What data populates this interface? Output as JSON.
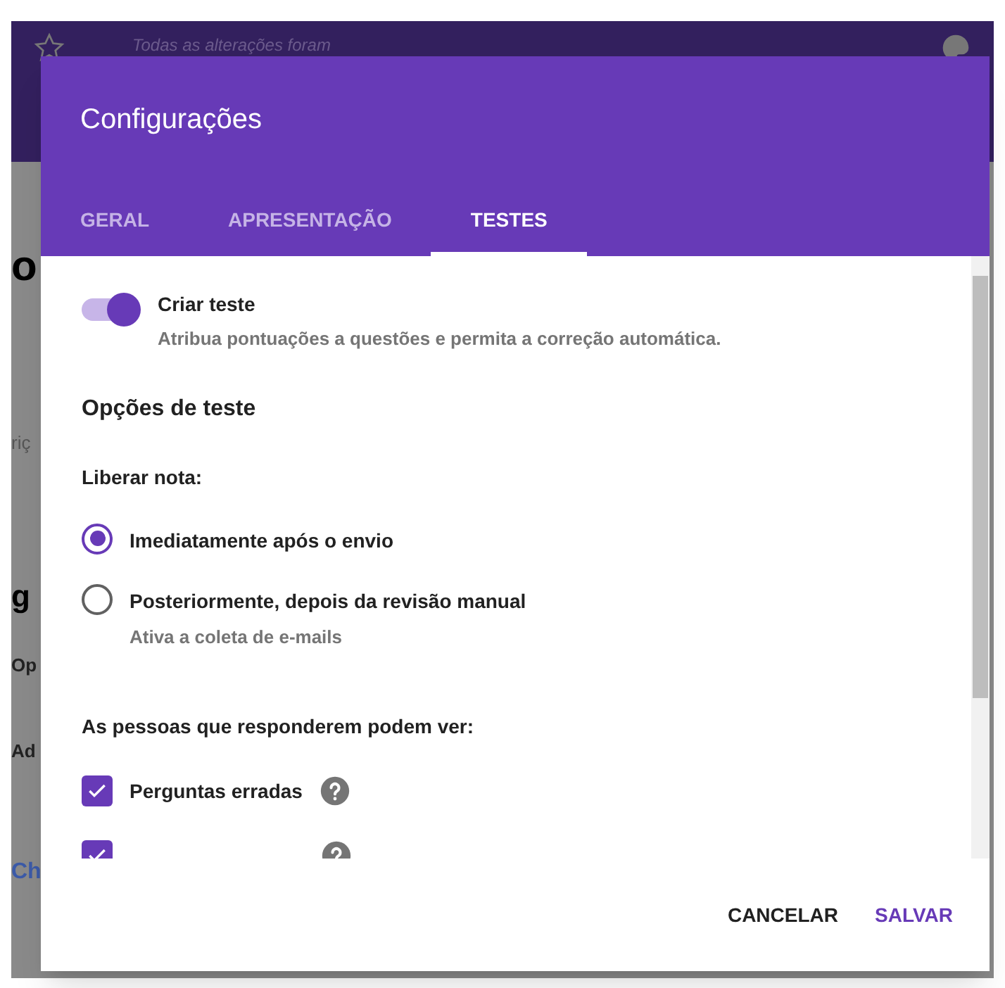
{
  "background": {
    "save_status": "Todas as alterações foram",
    "title_fragment": "o",
    "description_fragment": "riç",
    "section_fragment": "g",
    "item_fragments": [
      "Op",
      "Ad"
    ],
    "link_fragment": "Ch"
  },
  "dialog": {
    "title": "Configurações",
    "tabs": [
      {
        "label": "GERAL",
        "selected": false
      },
      {
        "label": "APRESENTAÇÃO",
        "selected": false
      },
      {
        "label": "TESTES",
        "selected": true
      }
    ],
    "quiz_toggle": {
      "label": "Criar teste",
      "description": "Atribua pontuações a questões e permita a correção automática.",
      "on": true
    },
    "section_title": "Opções de teste",
    "release_label": "Liberar nota:",
    "release_options": [
      {
        "label": "Imediatamente após o envio",
        "selected": true
      },
      {
        "label": "Posteriormente, depois da revisão manual",
        "sublabel": "Ativa a coleta de e-mails",
        "selected": false
      }
    ],
    "visibility_label": "As pessoas que responderem podem ver:",
    "visibility_options": [
      {
        "label": "Perguntas erradas",
        "checked": true
      },
      {
        "checked": true
      }
    ],
    "buttons": [
      {
        "label": "CANCELAR",
        "kind": "text"
      },
      {
        "label": "SALVAR",
        "kind": "primary"
      }
    ]
  }
}
